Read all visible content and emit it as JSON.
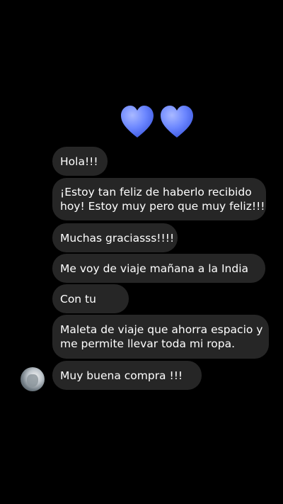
{
  "colors": {
    "background": "#000000",
    "bubble": "#262626",
    "text": "#ffffff",
    "heart": "#6b86ff"
  },
  "header": {
    "emoji": "blue-heart-icon x2"
  },
  "messages": [
    {
      "lines": [
        "Hola!!!"
      ]
    },
    {
      "lines": [
        "¡Estoy tan feliz de haberlo recibido",
        "hoy! Estoy muy pero que muy feliz!!!"
      ]
    },
    {
      "lines": [
        "Muchas graciasss!!!!"
      ]
    },
    {
      "lines": [
        "Me voy de viaje mañana a la India"
      ]
    },
    {
      "lines": [
        "Con tu"
      ]
    },
    {
      "lines": [
        "Maleta de viaje que ahorra espacio y",
        "me permite llevar toda mi ropa."
      ]
    },
    {
      "lines": [
        "Muy buena compra !!!"
      ]
    }
  ]
}
